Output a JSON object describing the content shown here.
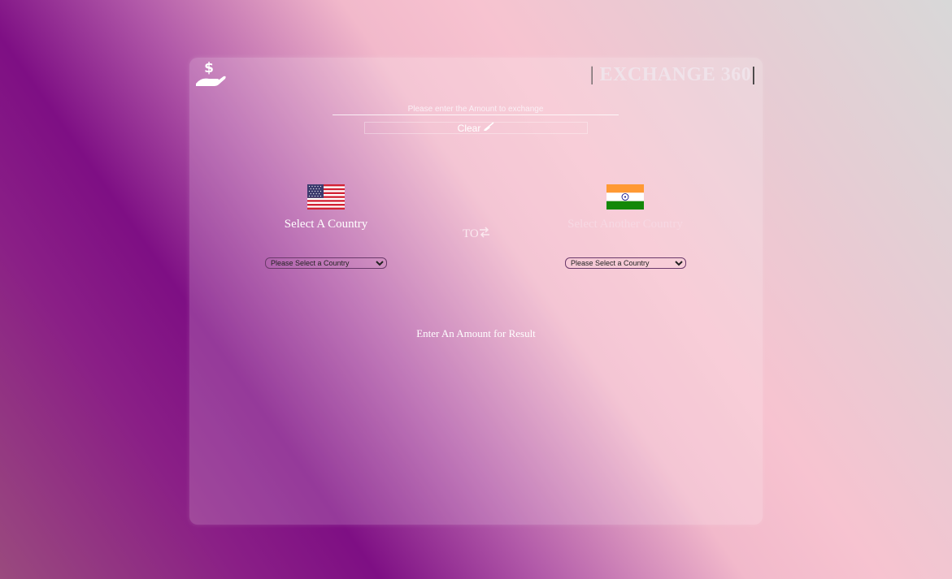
{
  "header": {
    "brand_left_bar": "|",
    "brand_name": "EXCHANGE 360",
    "brand_right_bar": "|"
  },
  "logo": {
    "icon": "money-hand-icon"
  },
  "amount": {
    "placeholder": "Please enter the Amount to exchange",
    "value": ""
  },
  "clear": {
    "label": "Clear",
    "icon": "broom-icon"
  },
  "from_country": {
    "label": "Select A Country",
    "flag": "us-flag",
    "select_placeholder": "Please Select a Country"
  },
  "to_country": {
    "label": "Select Another Country",
    "flag": "india-flag",
    "select_placeholder": "Please Select a Country"
  },
  "swap": {
    "label": "TO",
    "icon": "swap-arrows-icon"
  },
  "result": {
    "text": "Enter An Amount for Result"
  },
  "colors": {
    "card_overlay": "rgba(255,255,255,0.18)",
    "text": "#ffffff",
    "brand": "#f0e3ea"
  }
}
